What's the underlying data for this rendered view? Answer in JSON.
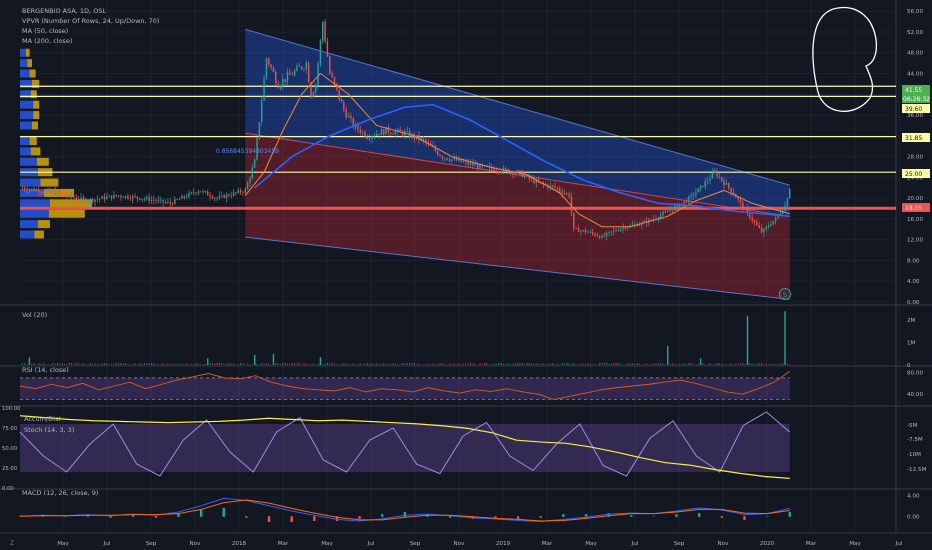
{
  "colors": {
    "background": "#131722",
    "grid": "#1e222d",
    "axis_text": "#b2b5be",
    "candle_up": "#26a69a",
    "candle_down": "#ef5350",
    "ma50": "#f0883e",
    "ma200": "#2962ff",
    "horizontal_levels": "#fffca8",
    "red_level": "#ef5350",
    "channel_upper": "#2962ff",
    "channel_lower": "#b22833",
    "rsi_line": "#e05a1f",
    "rsi_band": "#7e57c2",
    "stoch_k": "#9b8ce6",
    "accum_dist": "#ffeb3b",
    "macd_line": "#2962ff",
    "signal_line": "#ff6d00",
    "vpvr_up": "#2962ff",
    "vpvr_down": "#f0b90b",
    "annotation": "#ffffff",
    "price_tag_green": "#4caf50",
    "price_tag_red": "#ef5350"
  },
  "legend": {
    "title": "BERGENBIO ASA, 1D, OSL",
    "vpvr": "VPVR (Number Of Rows, 24, Up/Down, 70)",
    "ma50": "MA (50, close)",
    "ma200": "MA (200, close)",
    "vol": "Vol (20)",
    "rsi": "RSI (14, close)",
    "accum": "Accum/Dist",
    "stoch": "Stoch (14, 3, 3)",
    "macd": "MACD (12, 26, close, 9)"
  },
  "channel_label": "0.856845394803459",
  "event_marker": "S",
  "footer_mark": "Z",
  "price_tags": {
    "last": "41.55",
    "countdown": "06:26:32",
    "level_b": "39.60",
    "level_c": "31.85",
    "level_d": "25.00",
    "red": "18.05"
  },
  "chart_data": [
    {
      "type": "candlestick",
      "panel": "price",
      "ylim": [
        0,
        57
      ],
      "y_ticks": [
        "0.00",
        "4.00",
        "8.00",
        "12.00",
        "16.00",
        "20.00",
        "24.00",
        "28.00",
        "32.00",
        "36.00",
        "40.00",
        "44.00",
        "48.00",
        "52.00",
        "56.00"
      ],
      "x_ticks": [
        "May",
        "Jul",
        "Sep",
        "Nov",
        "2018",
        "Mar",
        "May",
        "Jul",
        "Sep",
        "Nov",
        "2019",
        "Mar",
        "May",
        "Jul",
        "Sep",
        "Nov",
        "2020",
        "Mar",
        "May",
        "Jul"
      ],
      "approx_close_path": [
        {
          "t": 0,
          "close": 22.0
        },
        {
          "t": 8,
          "close": 21.0
        },
        {
          "t": 14,
          "close": 19.5
        },
        {
          "t": 21,
          "close": 20.5
        },
        {
          "t": 26,
          "close": 20.0
        },
        {
          "t": 32,
          "close": 19.0
        },
        {
          "t": 38,
          "close": 21.5
        },
        {
          "t": 42,
          "close": 20.0
        },
        {
          "t": 48,
          "close": 21.5
        },
        {
          "t": 50,
          "close": 27.0
        },
        {
          "t": 51,
          "close": 35.0
        },
        {
          "t": 52.5,
          "close": 47.0
        },
        {
          "t": 55,
          "close": 42.0
        },
        {
          "t": 58,
          "close": 44.0
        },
        {
          "t": 61,
          "close": 46.0
        },
        {
          "t": 62,
          "close": 40.0
        },
        {
          "t": 63,
          "close": 42.0
        },
        {
          "t": 64.5,
          "close": 54.0
        },
        {
          "t": 66,
          "close": 44.0
        },
        {
          "t": 69,
          "close": 37.0
        },
        {
          "t": 71,
          "close": 34.0
        },
        {
          "t": 74,
          "close": 32.0
        },
        {
          "t": 78,
          "close": 33.0
        },
        {
          "t": 82,
          "close": 32.5
        },
        {
          "t": 86,
          "close": 31.0
        },
        {
          "t": 90,
          "close": 28.0
        },
        {
          "t": 94,
          "close": 27.0
        },
        {
          "t": 98,
          "close": 26.0
        },
        {
          "t": 102,
          "close": 25.5
        },
        {
          "t": 106,
          "close": 25.0
        },
        {
          "t": 110,
          "close": 23.0
        },
        {
          "t": 114,
          "close": 22.0
        },
        {
          "t": 117,
          "close": 20.5
        },
        {
          "t": 118,
          "close": 14.0
        },
        {
          "t": 121,
          "close": 13.5
        },
        {
          "t": 124,
          "close": 12.5
        },
        {
          "t": 126,
          "close": 13.5
        },
        {
          "t": 129,
          "close": 14.5
        },
        {
          "t": 132,
          "close": 15.0
        },
        {
          "t": 135,
          "close": 16.0
        },
        {
          "t": 138,
          "close": 17.5
        },
        {
          "t": 142,
          "close": 19.5
        },
        {
          "t": 145,
          "close": 22.0
        },
        {
          "t": 148,
          "close": 25.0
        },
        {
          "t": 150,
          "close": 23.0
        },
        {
          "t": 152,
          "close": 21.0
        },
        {
          "t": 155,
          "close": 17.0
        },
        {
          "t": 158,
          "close": 13.5
        },
        {
          "t": 161,
          "close": 16.0
        },
        {
          "t": 163,
          "close": 18.5
        },
        {
          "t": 164,
          "close": 22.0
        }
      ],
      "ma50_path": [
        {
          "t": 48,
          "value": 20.5
        },
        {
          "t": 52,
          "value": 25.0
        },
        {
          "t": 56,
          "value": 33.0
        },
        {
          "t": 60,
          "value": 40.0
        },
        {
          "t": 64,
          "value": 44.0
        },
        {
          "t": 70,
          "value": 40.0
        },
        {
          "t": 76,
          "value": 34.0
        },
        {
          "t": 84,
          "value": 32.0
        },
        {
          "t": 92,
          "value": 28.0
        },
        {
          "t": 100,
          "value": 26.0
        },
        {
          "t": 108,
          "value": 24.5
        },
        {
          "t": 115,
          "value": 21.0
        },
        {
          "t": 119,
          "value": 17.0
        },
        {
          "t": 124,
          "value": 14.5
        },
        {
          "t": 130,
          "value": 14.5
        },
        {
          "t": 138,
          "value": 16.5
        },
        {
          "t": 144,
          "value": 19.5
        },
        {
          "t": 150,
          "value": 21.5
        },
        {
          "t": 156,
          "value": 19.0
        },
        {
          "t": 164,
          "value": 17.0
        }
      ],
      "ma200_path": [
        {
          "t": 50,
          "value": 22.0
        },
        {
          "t": 58,
          "value": 28.0
        },
        {
          "t": 66,
          "value": 32.0
        },
        {
          "t": 74,
          "value": 35.0
        },
        {
          "t": 82,
          "value": 37.5
        },
        {
          "t": 88,
          "value": 38.0
        },
        {
          "t": 96,
          "value": 35.0
        },
        {
          "t": 104,
          "value": 31.0
        },
        {
          "t": 112,
          "value": 27.0
        },
        {
          "t": 120,
          "value": 23.5
        },
        {
          "t": 128,
          "value": 21.0
        },
        {
          "t": 136,
          "value": 19.0
        },
        {
          "t": 144,
          "value": 18.5
        },
        {
          "t": 152,
          "value": 17.5
        },
        {
          "t": 164,
          "value": 16.5
        }
      ],
      "channel": {
        "upper": {
          "start": {
            "t": 48,
            "price": 52.5
          },
          "end": {
            "t": 164,
            "price": 22.5
          }
        },
        "middle": {
          "start": {
            "t": 48,
            "price": 32.5
          },
          "end": {
            "t": 164,
            "price": 16.5
          }
        },
        "lower": {
          "start": {
            "t": 48,
            "price": 12.5
          },
          "end": {
            "t": 164,
            "price": 0.5
          }
        }
      },
      "horizontal_levels": [
        41.55,
        39.6,
        31.85,
        25.0
      ],
      "red_level": 18.05,
      "vpvr_rows": [
        {
          "price": 48.0,
          "up": 10,
          "down": 6
        },
        {
          "price": 46.0,
          "up": 12,
          "down": 8
        },
        {
          "price": 44.0,
          "up": 16,
          "down": 10
        },
        {
          "price": 42.0,
          "up": 20,
          "down": 12
        },
        {
          "price": 40.0,
          "up": 18,
          "down": 10
        },
        {
          "price": 38.0,
          "up": 22,
          "down": 10
        },
        {
          "price": 36.0,
          "up": 22,
          "down": 10
        },
        {
          "price": 34.0,
          "up": 20,
          "down": 10
        },
        {
          "price": 31.0,
          "up": 16,
          "down": 12
        },
        {
          "price": 29.0,
          "up": 18,
          "down": 16
        },
        {
          "price": 27.0,
          "up": 28,
          "down": 20
        },
        {
          "price": 25.0,
          "up": 30,
          "down": 24
        },
        {
          "price": 23.0,
          "up": 34,
          "down": 30
        },
        {
          "price": 21.0,
          "up": 40,
          "down": 50
        },
        {
          "price": 19.0,
          "up": 50,
          "down": 70
        },
        {
          "price": 17.0,
          "up": 48,
          "down": 60
        },
        {
          "price": 15.0,
          "up": 30,
          "down": 20
        },
        {
          "price": 13.0,
          "up": 24,
          "down": 16
        }
      ]
    },
    {
      "type": "bar",
      "panel": "volume",
      "ylim": [
        0,
        2.5
      ],
      "y_ticks": [
        "0",
        "1M",
        "2M"
      ],
      "spikes": [
        {
          "t": 2,
          "value": 0.35
        },
        {
          "t": 40,
          "value": 0.3
        },
        {
          "t": 50,
          "value": 0.45
        },
        {
          "t": 54,
          "value": 0.5
        },
        {
          "t": 64,
          "value": 0.35
        },
        {
          "t": 138,
          "value": 0.85
        },
        {
          "t": 145,
          "value": 0.3
        },
        {
          "t": 155,
          "value": 2.2
        },
        {
          "t": 163,
          "value": 2.4
        }
      ]
    },
    {
      "type": "line",
      "panel": "rsi",
      "ylim": [
        20,
        90
      ],
      "y_ticks": [
        "40.00",
        "80.00"
      ],
      "bands": [
        30,
        70
      ],
      "values": [
        55,
        50,
        58,
        52,
        60,
        48,
        55,
        62,
        50,
        58,
        66,
        72,
        78,
        70,
        68,
        74,
        62,
        55,
        50,
        48,
        46,
        52,
        44,
        50,
        48,
        44,
        52,
        46,
        42,
        48,
        45,
        50,
        44,
        40,
        30,
        36,
        42,
        48,
        52,
        55,
        58,
        62,
        66,
        60,
        52,
        44,
        40,
        50,
        62,
        82
      ]
    },
    {
      "type": "line",
      "panel": "stoch_accum",
      "ylim": [
        0,
        100
      ],
      "y_ticks": [
        "0.00",
        "25.00",
        "50.00",
        "75.00",
        "100.00"
      ],
      "right_ticks": [
        "-5M",
        "-7.5M",
        "-10M",
        "-12.5M"
      ],
      "series": [
        {
          "name": "Accum/Dist",
          "values": [
            -2.6,
            -2.9,
            -3.2,
            -3.4,
            -3.5,
            -3.6,
            -3.7,
            -3.6,
            -3.5,
            -3.3,
            -3.0,
            -3.2,
            -3.4,
            -3.3,
            -3.5,
            -3.7,
            -3.9,
            -4.2,
            -4.6,
            -5.3,
            -6.5,
            -6.8,
            -7.0,
            -7.6,
            -8.4,
            -9.3,
            -10.1,
            -10.5,
            -11.2,
            -11.8,
            -12.3,
            -12.6
          ]
        },
        {
          "name": "Stoch (14, 3, 3)",
          "values": [
            70,
            40,
            20,
            55,
            80,
            30,
            15,
            60,
            85,
            45,
            20,
            70,
            88,
            35,
            20,
            60,
            75,
            30,
            18,
            65,
            82,
            40,
            22,
            55,
            80,
            28,
            15,
            62,
            84,
            40,
            20,
            78,
            95,
            70
          ]
        }
      ],
      "bands": [
        20,
        80
      ]
    },
    {
      "type": "bar",
      "panel": "macd",
      "ylim": [
        -3,
        5
      ],
      "y_ticks": [
        "0.00",
        "4.00"
      ],
      "macd_values": [
        0,
        0.2,
        0.1,
        0.3,
        0.1,
        0.4,
        0.2,
        0.8,
        2.0,
        3.4,
        3.0,
        2.0,
        1.0,
        0.2,
        -0.6,
        -0.9,
        -0.5,
        0.2,
        0.4,
        0.1,
        -0.3,
        -0.5,
        -0.8,
        -1.0,
        -0.6,
        -0.2,
        0.4,
        0.6,
        0.5,
        1.0,
        1.6,
        1.2,
        0.3,
        0.5,
        1.5
      ],
      "signal_values": [
        0,
        0.1,
        0.1,
        0.2,
        0.2,
        0.3,
        0.3,
        0.5,
        1.3,
        2.6,
        3.1,
        2.5,
        1.5,
        0.6,
        -0.2,
        -0.7,
        -0.7,
        -0.2,
        0.2,
        0.2,
        -0.1,
        -0.4,
        -0.6,
        -0.9,
        -0.8,
        -0.4,
        0.1,
        0.5,
        0.5,
        0.8,
        1.3,
        1.3,
        0.6,
        0.5,
        1.1
      ]
    }
  ]
}
